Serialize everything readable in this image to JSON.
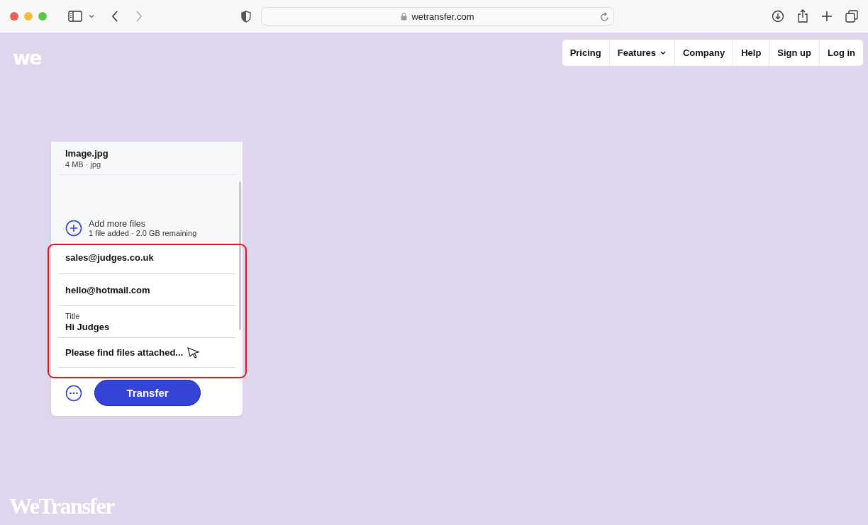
{
  "browser": {
    "address": "wetransfer.com"
  },
  "logo": "we",
  "nav": [
    {
      "label": "Pricing",
      "dropdown": false
    },
    {
      "label": "Features",
      "dropdown": true
    },
    {
      "label": "Company",
      "dropdown": false
    },
    {
      "label": "Help",
      "dropdown": false
    },
    {
      "label": "Sign up",
      "dropdown": false
    },
    {
      "label": "Log in",
      "dropdown": false
    }
  ],
  "file": {
    "name": "Image.jpg",
    "meta": "4 MB · jpg"
  },
  "add_files": {
    "label": "Add more files",
    "status": "1 file added · 2.0 GB remaining"
  },
  "form": {
    "email_to": "sales@judges.co.uk",
    "email_from": "hello@hotmail.com",
    "title_label": "Title",
    "title": "Hi Judges",
    "message": "Please find files attached..."
  },
  "transfer_button": "Transfer",
  "wordmark": "WeTransfer"
}
